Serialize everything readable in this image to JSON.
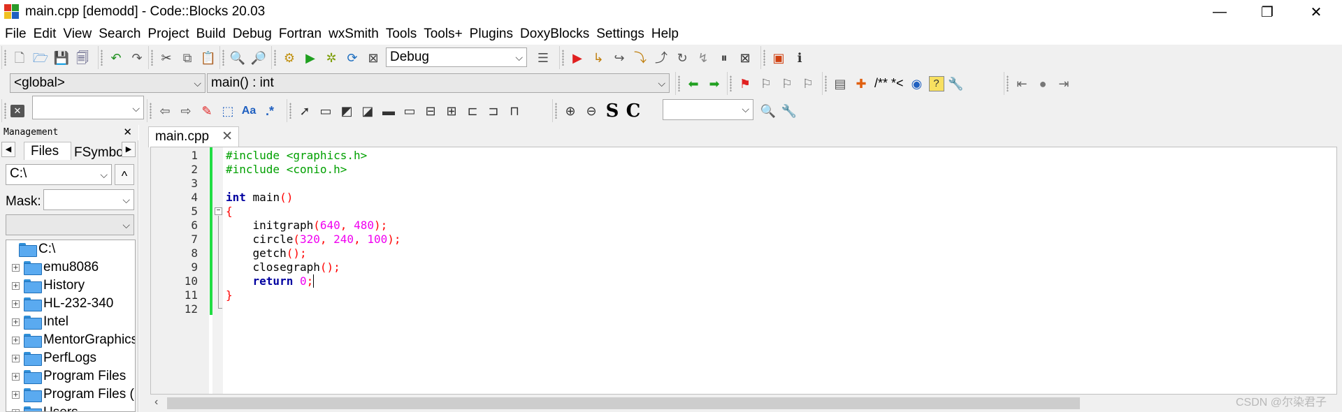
{
  "window": {
    "title": "main.cpp [demodd] - Code::Blocks 20.03",
    "minimize_glyph": "—",
    "maximize_glyph": "❐",
    "close_glyph": "✕"
  },
  "menu": [
    "File",
    "Edit",
    "View",
    "Search",
    "Project",
    "Build",
    "Debug",
    "Fortran",
    "wxSmith",
    "Tools",
    "Tools+",
    "Plugins",
    "DoxyBlocks",
    "Settings",
    "Help"
  ],
  "toolbar": {
    "build_target": "Debug",
    "scope": "<global>",
    "function": "main() : int",
    "doxy_comment": "/** *<",
    "search_text": "",
    "regex_label": ".*",
    "aa_label": "Aa",
    "s_label": "S",
    "c_label": "C"
  },
  "management": {
    "title": "Management",
    "tabs": [
      "Files",
      "FSymbo"
    ],
    "path_value": "C:\\",
    "up_label": "^",
    "mask_label": "Mask:",
    "mask_value": "",
    "tree_root": "C:\\",
    "tree_items": [
      "emu8086",
      "History",
      "HL-232-340",
      "Intel",
      "MentorGraphics",
      "PerfLogs",
      "Program Files",
      "Program Files (",
      "Users"
    ]
  },
  "editor": {
    "tab_label": "main.cpp",
    "line_numbers": [
      "1",
      "2",
      "3",
      "4",
      "5",
      "6",
      "7",
      "8",
      "9",
      "10",
      "11",
      "12"
    ]
  },
  "colors": {
    "preprocessor": "#00a000",
    "keyword": "#0000a0",
    "number": "#f000f0",
    "operator": "#ff0000",
    "changebar": "#22dd44"
  },
  "watermark": "CSDN @尔染君子"
}
